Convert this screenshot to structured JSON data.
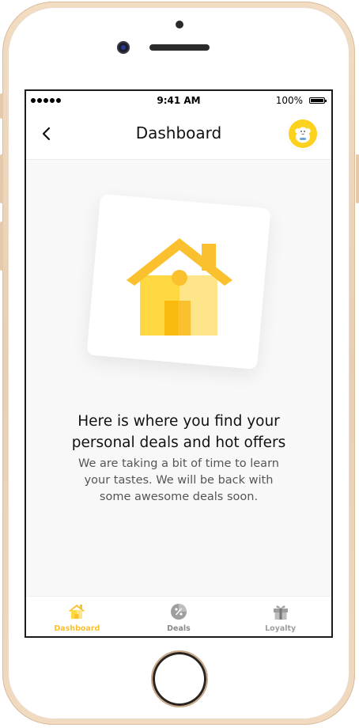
{
  "status_bar": {
    "time": "9:41 AM",
    "battery": "100%"
  },
  "nav": {
    "title": "Dashboard",
    "back_icon": "chevron-left-icon",
    "avatar_icon": "avatar-mascot-icon"
  },
  "empty_state": {
    "illustration": "house-icon",
    "headline_line1": "Here is where you find your",
    "headline_line2": "personal deals and hot offers",
    "body_line1": "We are taking a bit of time to learn",
    "body_line2": "your tastes. We will be back with",
    "body_line3": "some awesome deals soon."
  },
  "tabs": [
    {
      "label": "Dashboard",
      "icon": "home-icon",
      "active": true
    },
    {
      "label": "Deals",
      "icon": "percent-badge-icon",
      "active": false
    },
    {
      "label": "Loyalty",
      "icon": "gift-icon",
      "active": false
    }
  ],
  "colors": {
    "accent": "#FCD21F",
    "inactive": "#9E9E9E"
  }
}
